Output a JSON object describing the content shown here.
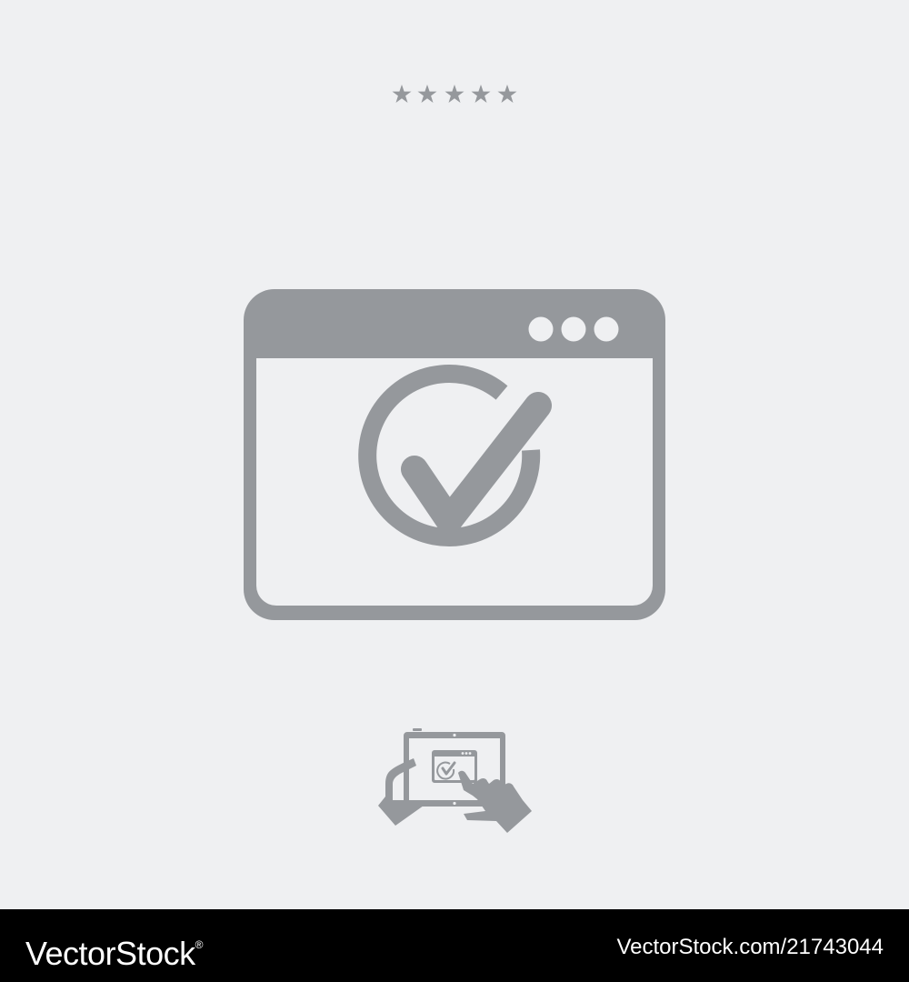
{
  "colors": {
    "background": "#eff0f2",
    "icon": "#95989c",
    "footer_background": "#000000",
    "footer_text": "#ffffff"
  },
  "rating": {
    "icon": "star-icon",
    "stars": 5
  },
  "main_icon": {
    "icon": "browser-window-checkmark-icon",
    "window_dots": 3
  },
  "small_icon": {
    "icon": "tablet-hands-touch-icon"
  },
  "footer": {
    "brand": "VectorStock",
    "brand_mark": "®",
    "asset_id": "VectorStock.com/21743044"
  }
}
